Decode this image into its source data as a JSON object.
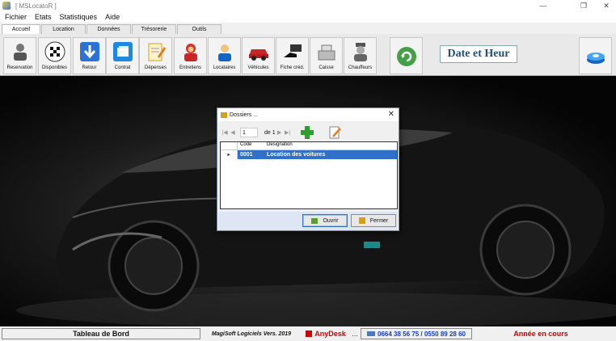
{
  "window": {
    "title": "[ MSLocatoR ]",
    "minimize": "—",
    "restore": "❐",
    "close": "✕"
  },
  "menu": [
    "Fichier",
    "Etats",
    "Statistiques",
    "Aide"
  ],
  "tabs": [
    "Accueil",
    "Location",
    "Données",
    "Trésorerie",
    "Outils"
  ],
  "toolbar": {
    "buttons": [
      {
        "label": "Reservation",
        "icon": "reservation-person-icon"
      },
      {
        "label": "Disponibles",
        "icon": "checkered-flag-icon"
      },
      {
        "label": "Retour",
        "icon": "down-arrow-icon"
      },
      {
        "label": "Contrat",
        "icon": "contract-papers-icon"
      },
      {
        "label": "Dépenses",
        "icon": "expense-notepad-icon"
      },
      {
        "label": "Entretiens",
        "icon": "mechanic-icon"
      },
      {
        "label": "Locataires",
        "icon": "tenant-person-icon"
      },
      {
        "label": "Véhicules",
        "icon": "red-car-icon"
      },
      {
        "label": "Fiche créd.",
        "icon": "credit-hand-icon"
      },
      {
        "label": "Caisse",
        "icon": "cash-register-icon"
      },
      {
        "label": "Chauffeurs",
        "icon": "driver-icon"
      }
    ],
    "refresh_icon": "green-refresh-icon",
    "date_label": "Date et Heur",
    "disk_icon": "disk-icon"
  },
  "dialog": {
    "title": "Dossiers ...",
    "close": "✕",
    "nav": {
      "first": "|◀",
      "prev": "◀",
      "position": "1",
      "of": "de 1",
      "next": "▶",
      "last": "▶|"
    },
    "add_icon": "green-plus-icon",
    "edit_icon": "edit-pencil-icon",
    "columns": {
      "code": "Code",
      "designation": "Designation"
    },
    "rows": [
      {
        "indicator": "▸",
        "code": "0001",
        "designation": "Location des voitures"
      }
    ],
    "open_label": "Ouvrir",
    "close_label": "Fermer"
  },
  "status": {
    "dashboard": "Tableau de Bord",
    "version": "MagiSoft Logiciels Vers. 2019",
    "anydesk": "AnyDesk",
    "separator": "...",
    "phones": "0664 38 56 75 / 0550 89 28 60",
    "year": "Année en cours"
  },
  "colors": {
    "selection": "#3070c8",
    "status_red": "#d00000",
    "phones_blue": "#1a3fb0",
    "date_blue": "#1f4e79"
  }
}
